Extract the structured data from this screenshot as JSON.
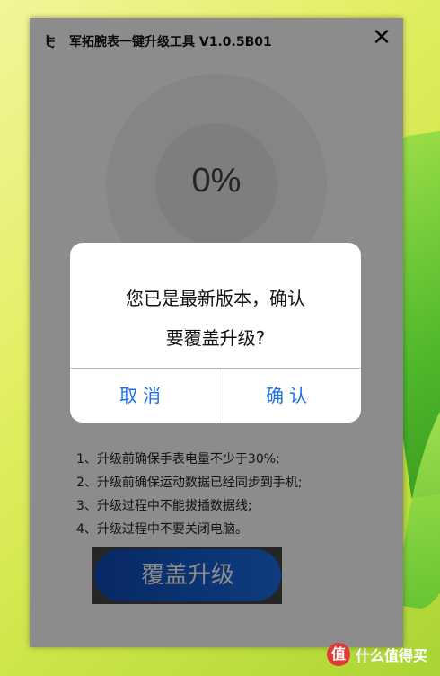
{
  "window": {
    "logo_glyph": "ꕟ",
    "title": "军拓腕表一键升级工具 V1.0.5B01",
    "close_glyph": "✕"
  },
  "progress": {
    "percent_text": "0%",
    "value": 0
  },
  "notes": [
    "1、升级前确保手表电量不少于30%;",
    "2、升级前确保运动数据已经同步到手机;",
    "3、升级过程中不能拔插数据线;",
    "4、升级过程中不要关闭电脑。"
  ],
  "primary_button": {
    "label": "覆盖升级"
  },
  "dialog": {
    "message_line1": "您已是最新版本，确认",
    "message_line2": "要覆盖升级?",
    "cancel_label": "取消",
    "confirm_label": "确认"
  },
  "watermark": {
    "icon_glyph": "值",
    "text": "什么值得买"
  },
  "colors": {
    "accent": "#1a6ee6",
    "button_gradient_start": "#0f4bb8"
  }
}
